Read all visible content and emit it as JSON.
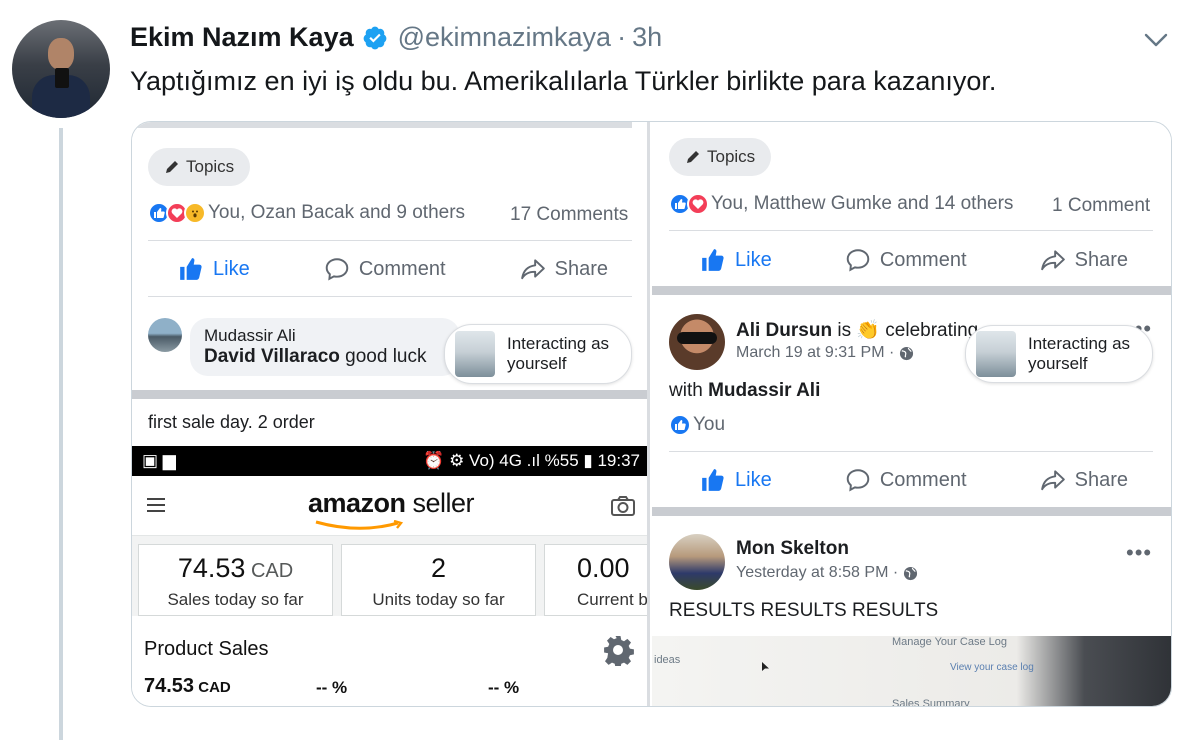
{
  "tweet": {
    "display_name": "Ekim Nazım Kaya",
    "handle": "@ekimnazimkaya",
    "separator": "·",
    "time": "3h",
    "text": "Yaptığımız en iyi iş oldu bu. Amerikalılarla Türkler birlikte para kazanıyor."
  },
  "left_screenshot": {
    "topics_label": "Topics",
    "reactions_text": "You, Ozan Bacak and 9 others",
    "comments_count": "17 Comments",
    "actions": {
      "like": "Like",
      "comment": "Comment",
      "share": "Share"
    },
    "comment": {
      "author": "Mudassir Ali",
      "mention": "David Villaraco",
      "text": " good luck"
    },
    "interacting": {
      "line1": "Interacting as",
      "line2": "yourself"
    },
    "post_text": "first sale day. 2 order",
    "phone_status": {
      "left": "▣ ▆",
      "right": "⏰ ⚙ Vo) 4G .ıl %55 ▮ 19:37"
    },
    "amazon": {
      "logo_bold": "amazon",
      "logo_rest": " seller",
      "metrics": [
        {
          "value": "74.53",
          "unit": " CAD",
          "label": "Sales today so far"
        },
        {
          "value": "2",
          "unit": "",
          "label": "Units today so far"
        },
        {
          "value": "0.00",
          "unit": "",
          "label": "Current b"
        }
      ],
      "product_sales_title": "Product Sales",
      "ps_value": "74.53",
      "ps_unit": " CAD",
      "ps_pct_1": "-- %",
      "ps_pct_2": "-- %"
    }
  },
  "right_screenshot": {
    "topics_label": "Topics",
    "reactions_text": "You, Matthew Gumke and 14 others",
    "comments_count": "1 Comment",
    "actions": {
      "like": "Like",
      "comment": "Comment",
      "share": "Share"
    },
    "post1": {
      "author": "Ali Dursun",
      "activity": " is 👏 celebrating",
      "meta": "March 19 at 9:31 PM ·",
      "with_prefix": "with ",
      "with_name": "Mudassir Ali",
      "reaction_text": "You"
    },
    "interacting": {
      "line1": "Interacting as",
      "line2": "yourself"
    },
    "post2": {
      "author": "Mon Skelton",
      "meta": "Yesterday at 8:58 PM ·",
      "text": "RESULTS RESULTS RESULTS",
      "more": "•••",
      "ss_manage": "Manage Your Case Log",
      "ss_view": "View your case log",
      "ss_ideas": "ideas",
      "ss_sales": "Sales Summary"
    },
    "more": "•••"
  },
  "colors": {
    "facebook_blue": "#1877f2",
    "twitter_blue": "#1da1f2",
    "muted_gray": "#657786"
  }
}
